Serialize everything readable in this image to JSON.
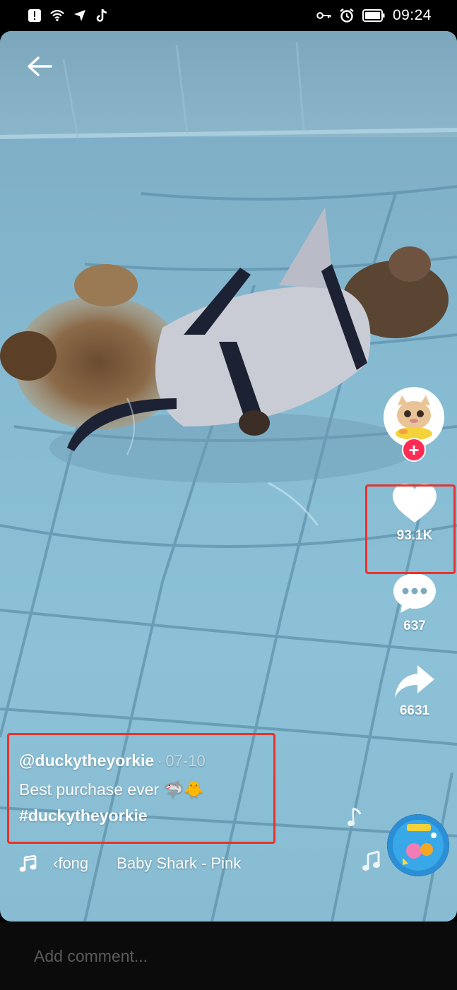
{
  "status_bar": {
    "time": "09:24"
  },
  "video": {
    "back_icon": "arrow-left-icon"
  },
  "actions": {
    "follow_symbol": "+",
    "likes": "93.1K",
    "comments": "637",
    "shares": "6631"
  },
  "caption": {
    "username": "@duckytheyorkie",
    "separator": "·",
    "date": "07-10",
    "text": "Best purchase ever 🦈🐥",
    "hashtag": "#duckytheyorkie"
  },
  "music": {
    "creator": "‹fong",
    "title": "Baby Shark - Pink"
  },
  "comment": {
    "placeholder": "Add comment..."
  },
  "colors": {
    "highlight": "#e8332a",
    "follow": "#fe2c55"
  }
}
